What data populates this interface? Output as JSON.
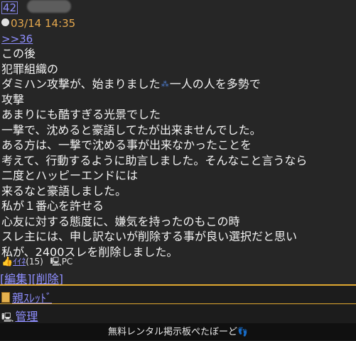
{
  "post": {
    "number": "42",
    "datetime": "03/14 14:35",
    "reply_link": ">>36",
    "lines": [
      "この後",
      "犯罪組織の",
      "ダミハン攻撃が、始まりました",
      "攻撃",
      "あまりにも酷すぎる光景でした",
      "一撃で、沈めると豪語してたが出来ませんでした。",
      "ある方は、一撃で沈める事が出来なかったことを",
      "考えて、行動するように助言しました。そんなこと言うなら",
      "二度とハッピーエンドには",
      "来るなと豪語しました。",
      "私が１番心を許せる",
      "心友に対する態度に、嫌気を持ったのもこの時",
      "スレ主には、申し訳ないが削除する事が良い選択だと思い",
      "私が、2400スレを削除しました。"
    ],
    "line3_suffix": "一人の人を多勢で",
    "like_label": "ｲｲﾈ",
    "like_count": "(15)",
    "device": "PC"
  },
  "actions": {
    "edit": "編集",
    "delete": "削除"
  },
  "nav": {
    "parent_thread": "親ｽﾚｯﾄﾞ",
    "admin": "管理"
  },
  "footer": {
    "text": "無料レンタル掲示板ぺたぼーど"
  },
  "colors": {
    "link": "#8f8fff",
    "date": "#e5a84e",
    "divider": "#e0a830"
  }
}
